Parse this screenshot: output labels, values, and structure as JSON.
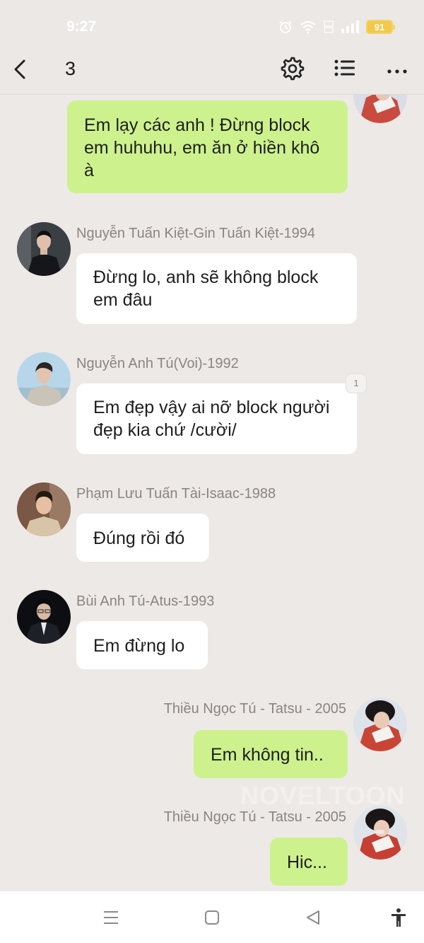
{
  "status": {
    "time": "9:27",
    "battery": "91",
    "icons": [
      "alarm-icon",
      "wifi-icon",
      "volte-icon",
      "signal-icon",
      "battery-icon"
    ]
  },
  "header": {
    "title": "3",
    "icons": [
      "back-icon",
      "settings-icon",
      "list-icon",
      "more-icon"
    ]
  },
  "messages": [
    {
      "direction": "out",
      "text": "Em lạy các anh ! Đừng block em huhuhu, em ăn ở  hiền khô à"
    },
    {
      "direction": "in",
      "sender": "Nguyễn Tuấn Kiệt-Gin Tuấn Kiệt-1994",
      "text": "Đừng lo, anh sẽ không block em đâu"
    },
    {
      "direction": "in",
      "sender": "Nguyễn Anh Tú(Voi)-1992",
      "text": "Em đẹp vậy ai nỡ block người đẹp kia chứ /cười/",
      "read_count": "1"
    },
    {
      "direction": "in",
      "sender": "Phạm Lưu Tuấn Tài-Isaac-1988",
      "text": "Đúng rồi đó"
    },
    {
      "direction": "in",
      "sender": "Bùi Anh Tú-Atus-1993",
      "text": "Em đừng lo"
    },
    {
      "direction": "out",
      "sender": "Thiều Ngọc Tú - Tatsu - 2005",
      "text": "Em không tin.."
    },
    {
      "direction": "out",
      "sender": "Thiều Ngọc Tú - Tatsu - 2005",
      "text": "Hic..."
    }
  ],
  "watermark": "NOVELTOON",
  "colors": {
    "background": "#ede9e6",
    "incoming_bubble": "#ffffff",
    "outgoing_bubble": "#cdf28d",
    "sender_text": "#8a8582",
    "battery": "#f2c94c"
  },
  "system_nav": [
    "menu-icon",
    "home-icon",
    "back-triangle-icon",
    "accessibility-icon"
  ]
}
